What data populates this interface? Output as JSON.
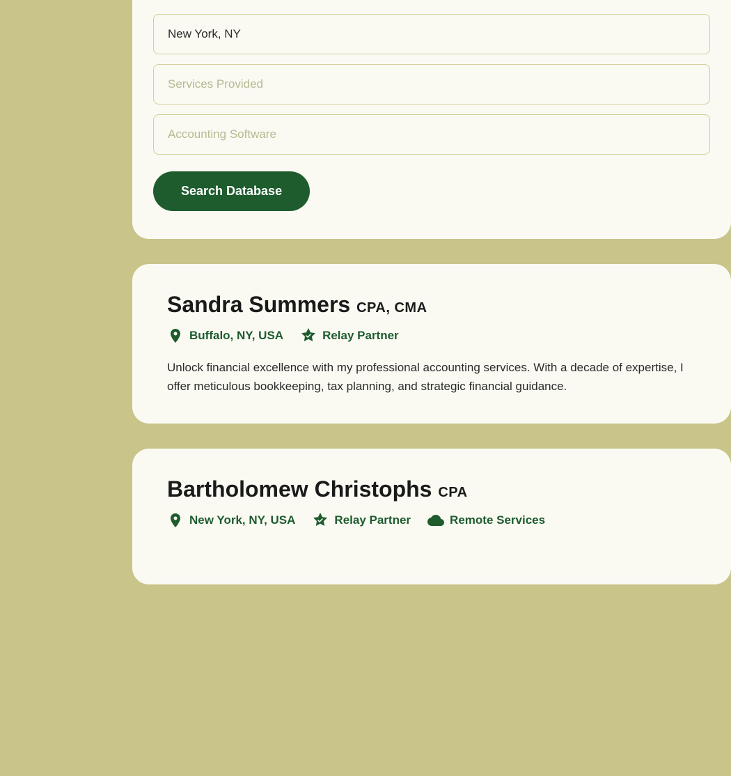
{
  "background": {
    "color": "#c9c48a"
  },
  "search_form": {
    "location_value": "New York, NY",
    "services_placeholder": "Services Provided",
    "software_placeholder": "Accounting Software",
    "button_label": "Search Database"
  },
  "results": [
    {
      "id": "sandra-summers",
      "first_name": "Sandra Summers",
      "credentials": "CPA, CMA",
      "location": "Buffalo, NY, USA",
      "badges": [
        "Relay Partner"
      ],
      "description": "Unlock financial excellence with my professional accounting services. With a decade of expertise, I offer meticulous bookkeeping, tax planning, and strategic financial guidance."
    },
    {
      "id": "bartholomew-christophs",
      "first_name": "Bartholomew Christophs",
      "credentials": "CPA",
      "location": "New York, NY, USA",
      "badges": [
        "Relay Partner",
        "Remote Services"
      ],
      "description": ""
    }
  ]
}
